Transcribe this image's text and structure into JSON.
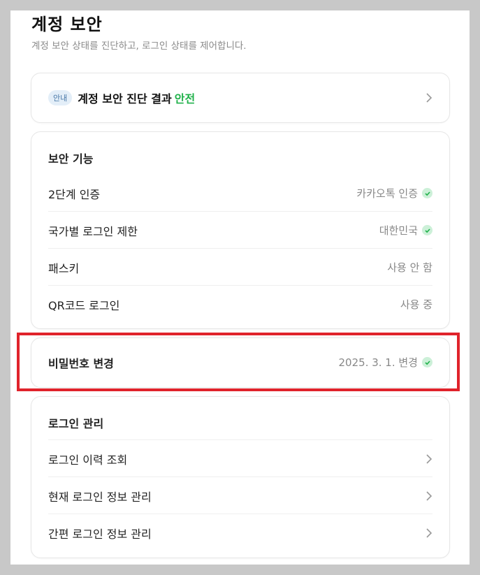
{
  "header": {
    "title": "계정 보안",
    "subtitle": "계정 보안 상태를 진단하고, 로그인 상태를 제어합니다."
  },
  "notice": {
    "badge": "안내",
    "text": "계정 보안 진단 결과",
    "status": "안전"
  },
  "security": {
    "title": "보안 기능",
    "items": [
      {
        "label": "2단계 인증",
        "value": "카카오톡 인증",
        "checked": true
      },
      {
        "label": "국가별 로그인 제한",
        "value": "대한민국",
        "checked": true
      },
      {
        "label": "패스키",
        "value": "사용 안 함",
        "checked": false
      },
      {
        "label": "QR코드 로그인",
        "value": "사용 중",
        "checked": false
      }
    ]
  },
  "password": {
    "label": "비밀번호 변경",
    "value": "2025. 3. 1. 변경",
    "checked": true
  },
  "login": {
    "title": "로그인 관리",
    "items": [
      {
        "label": "로그인 이력 조회"
      },
      {
        "label": "현재 로그인 정보 관리"
      },
      {
        "label": "간편 로그인 정보 관리"
      }
    ]
  },
  "colors": {
    "safe": "#21b24b",
    "check_bg": "#ccf0d8",
    "highlight": "#e0232b"
  }
}
